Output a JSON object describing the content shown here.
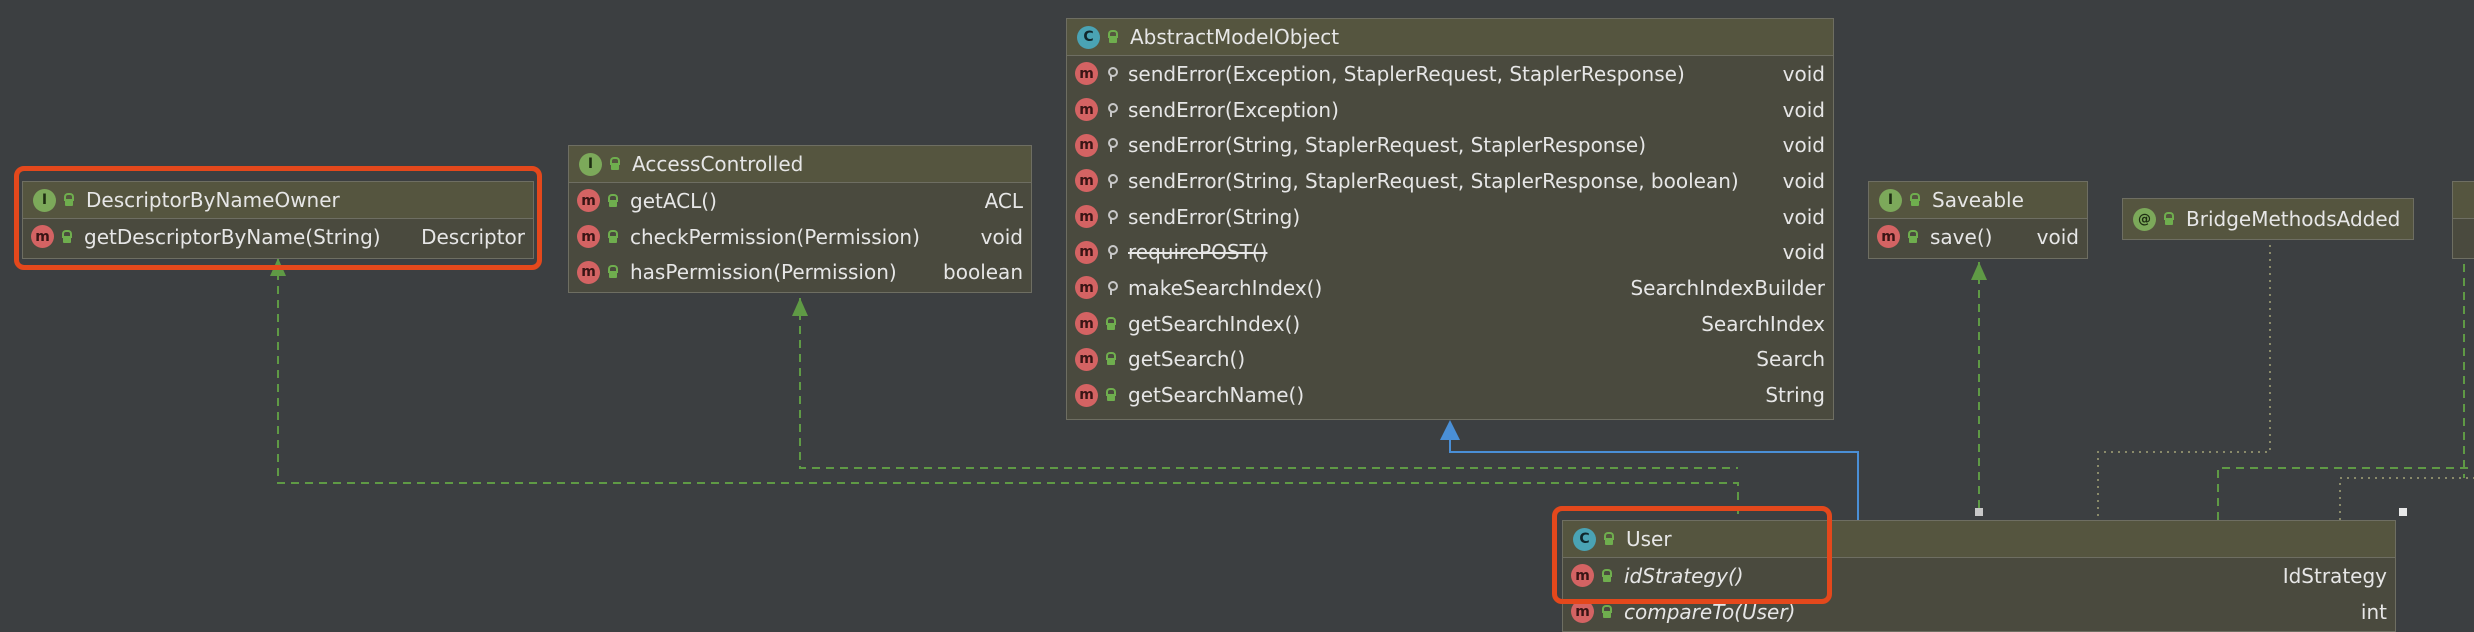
{
  "colors": {
    "background": "#3c3f41",
    "node_fill": "#4a4a3e",
    "interface_link": "#5f9a45",
    "extends_link": "#4a8fd6",
    "highlight": "#e4481c"
  },
  "nodes": {
    "descriptor_owner": {
      "title": "DescriptorByNameOwner",
      "kind_icon": "interface-icon",
      "methods": [
        {
          "name": "getDescriptorByName(String)",
          "type": "Descriptor"
        }
      ]
    },
    "access_controlled": {
      "title": "AccessControlled",
      "kind_icon": "interface-icon",
      "methods": [
        {
          "name": "getACL()",
          "type": "ACL"
        },
        {
          "name": "checkPermission(Permission)",
          "type": "void"
        },
        {
          "name": "hasPermission(Permission)",
          "type": "boolean"
        }
      ]
    },
    "abstract_model_object": {
      "title": "AbstractModelObject",
      "kind_icon": "abstract-class-icon",
      "methods": [
        {
          "name": "sendError(Exception, StaplerRequest, StaplerResponse)",
          "type": "void"
        },
        {
          "name": "sendError(Exception)",
          "type": "void"
        },
        {
          "name": "sendError(String, StaplerRequest, StaplerResponse)",
          "type": "void"
        },
        {
          "name": "sendError(String, StaplerRequest, StaplerResponse, boolean)",
          "type": "void"
        },
        {
          "name": "sendError(String)",
          "type": "void"
        },
        {
          "name": "requirePOST()",
          "type": "void"
        },
        {
          "name": "makeSearchIndex()",
          "type": "SearchIndexBuilder"
        },
        {
          "name": "getSearchIndex()",
          "type": "SearchIndex"
        },
        {
          "name": "getSearch()",
          "type": "Search"
        },
        {
          "name": "getSearchName()",
          "type": "String"
        }
      ]
    },
    "saveable": {
      "title": "Saveable",
      "kind_icon": "interface-icon",
      "methods": [
        {
          "name": "save()",
          "type": "void"
        }
      ]
    },
    "bridge_methods_added": {
      "title": "BridgeMethodsAdded",
      "kind_icon": "annotation-icon"
    },
    "user": {
      "title": "User",
      "kind_icon": "class-icon",
      "methods": [
        {
          "name": "idStrategy()",
          "type": "IdStrategy"
        },
        {
          "name": "compareTo(User)",
          "type": "int"
        }
      ]
    }
  }
}
